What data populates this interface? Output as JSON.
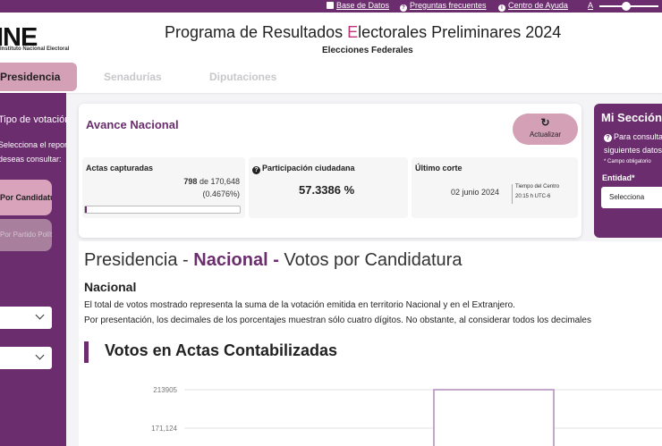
{
  "topbar": {
    "base_datos": "Base de Datos",
    "preguntas": "Preguntas frecuentes",
    "ayuda": "Centro de Ayuda",
    "font_label": "A"
  },
  "header": {
    "logo_text": "INE",
    "logo_sub": "Instituto Nacional Electoral",
    "title_pre": "Programa de Resultados ",
    "title_accent": "E",
    "title_post": "lectorales Preliminares 2024",
    "subtitle": "Elecciones Federales"
  },
  "tabs": [
    {
      "label": "Presidencia"
    },
    {
      "label": "Senadurías"
    },
    {
      "label": "Diputaciones"
    }
  ],
  "sidebar": {
    "votacion": "Tipo de votación",
    "reporte_line1": "Selecciona el reporte que",
    "reporte_line2": "deseas consultar:",
    "btn_candidatura": "Por Candidatura",
    "btn_partido": "Por Partido Político"
  },
  "avance": {
    "title": "Avance Nacional",
    "refresh_icon": "↻",
    "refresh_label": "Actualizar",
    "actas_label": "Actas capturadas",
    "actas_count": "798",
    "actas_of": " de 170,648",
    "actas_pct": "(0.4676%)",
    "actas_progress": 0.004676,
    "participacion_label": "Participación ciudadana",
    "participacion_value": "57.3386 %",
    "corte_label": "Último corte",
    "corte_date": "02 junio 2024",
    "corte_tz_line1": "Tiempo del Centro",
    "corte_tz_line2": "20:15 h UTC-6"
  },
  "mi_seccion": {
    "title": "Mi Sección",
    "help_line1": "Para consultar",
    "help_line2": "siguientes datos",
    "required": "* Campo obligatorio",
    "entidad_label": "Entidad*",
    "entidad_placeholder": "Selecciona"
  },
  "content": {
    "title_pre": "Presidencia - ",
    "title_bold": "Nacional -",
    "title_post": " Votos por Candidatura",
    "nacional": "Nacional",
    "desc1": "El total de votos mostrado representa la suma de la votación emitida en territorio Nacional y en el Extranjero.",
    "desc2": "Por presentación, los decimales de los porcentajes muestran sólo cuatro dígitos. No obstante, al considerar todos los decimales",
    "votos_title": "Votos en Actas Contabilizadas"
  },
  "colors": {
    "primary": "#6b2d6e",
    "accent_pink": "#d3a0b6",
    "title_accent": "#c0327a"
  },
  "chart_data": {
    "type": "bar",
    "y_ticks": [
      213905,
      171124
    ],
    "y_tick_labels": [
      "213905",
      "171,124"
    ],
    "values": [
      213905
    ],
    "grid": true
  }
}
